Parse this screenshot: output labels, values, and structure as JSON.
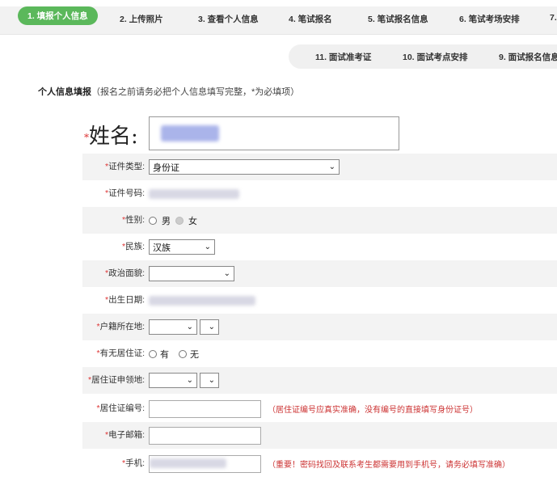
{
  "tabs_row1": [
    {
      "label": "1. 填报个人信息",
      "active": true
    },
    {
      "label": "2. 上传照片"
    },
    {
      "label": "3. 查看个人信息"
    },
    {
      "label": "4. 笔试报名"
    },
    {
      "label": "5. 笔试报名信息"
    },
    {
      "label": "6. 笔试考场安排"
    },
    {
      "label": "7."
    }
  ],
  "tabs_row2": [
    {
      "label": "11. 面试准考证"
    },
    {
      "label": "10. 面试考点安排"
    },
    {
      "label": "9. 面试报名信息"
    }
  ],
  "section": {
    "title": "个人信息填报",
    "hint": "（报名之前请务必把个人信息填写完整，*为必填项）"
  },
  "form": {
    "required_mark": "*",
    "name_label": "姓名:",
    "id_type_label": "证件类型:",
    "id_type_value": "身份证",
    "id_number_label": "证件号码:",
    "gender_label": "性别:",
    "gender_male": "男",
    "gender_female": "女",
    "ethnicity_label": "民族:",
    "ethnicity_value": "汉族",
    "political_label": "政治面貌:",
    "birth_label": "出生日期:",
    "hukou_label": "户籍所在地:",
    "residence_permit_label": "有无居住证:",
    "residence_permit_yes": "有",
    "residence_permit_no": "无",
    "permit_place_label": "居住证申领地:",
    "permit_number_label": "居住证编号:",
    "permit_number_note": "（居住证编号应真实准确，没有编号的直接填写身份证号）",
    "email_label": "电子邮箱:",
    "phone_label": "手机:",
    "phone_note": "（重要！密码找回及联系考生都需要用到手机号，请务必填写准确）"
  }
}
